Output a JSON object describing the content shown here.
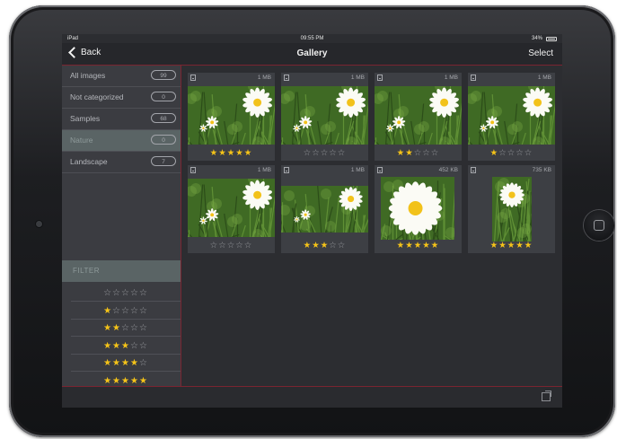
{
  "status": {
    "carrier": "iPad",
    "time": "09:55 PM",
    "battery": "34%"
  },
  "nav": {
    "back_label": "Back",
    "title": "Gallery",
    "select_label": "Select"
  },
  "sidebar": {
    "items": [
      {
        "label": "All images",
        "count": "99"
      },
      {
        "label": "Not categorized",
        "count": "0"
      },
      {
        "label": "Samples",
        "count": "68"
      },
      {
        "label": "Nature",
        "count": "0"
      },
      {
        "label": "Landscape",
        "count": "7"
      }
    ],
    "active_index": 3
  },
  "filter": {
    "title": "FILTER",
    "ratings": [
      0,
      1,
      2,
      3,
      4,
      5
    ]
  },
  "images": [
    {
      "size": "1 MB",
      "rating": 5
    },
    {
      "size": "1 MB",
      "rating": 0
    },
    {
      "size": "1 MB",
      "rating": 2
    },
    {
      "size": "1 MB",
      "rating": 1
    },
    {
      "size": "1 MB",
      "rating": 0
    },
    {
      "size": "1 MB",
      "rating": 3
    },
    {
      "size": "452 KB",
      "rating": 5
    },
    {
      "size": "735 KB",
      "rating": 5
    }
  ],
  "colors": {
    "star_active": "#f6c418",
    "star_inactive": "#9b9da2",
    "accent_line": "#7a2430",
    "selected_bg": "#5a6465"
  }
}
